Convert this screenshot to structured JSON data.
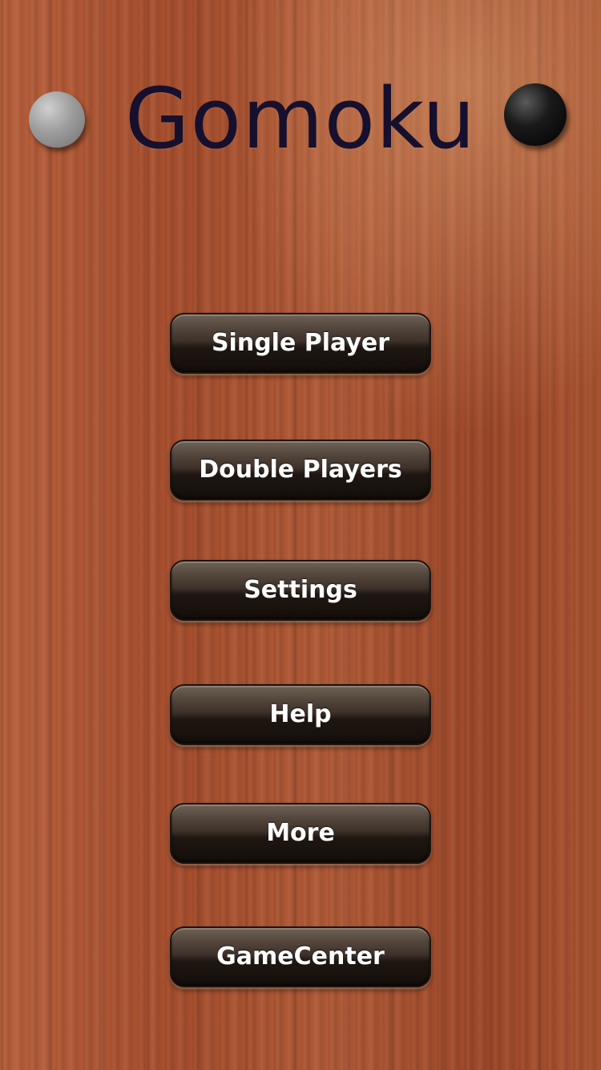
{
  "header": {
    "title": "Gomoku",
    "left_stone_icon": "white-stone-icon",
    "right_stone_icon": "black-stone-icon"
  },
  "menu": {
    "single_player": "Single Player",
    "double_players": "Double Players",
    "settings": "Settings",
    "help": "Help",
    "more": "More",
    "gamecenter": "GameCenter"
  },
  "colors": {
    "background_wood": "#a24d2e",
    "title_text": "#16102e",
    "button_text": "#ffffff",
    "button_dark": "#140e0a"
  }
}
